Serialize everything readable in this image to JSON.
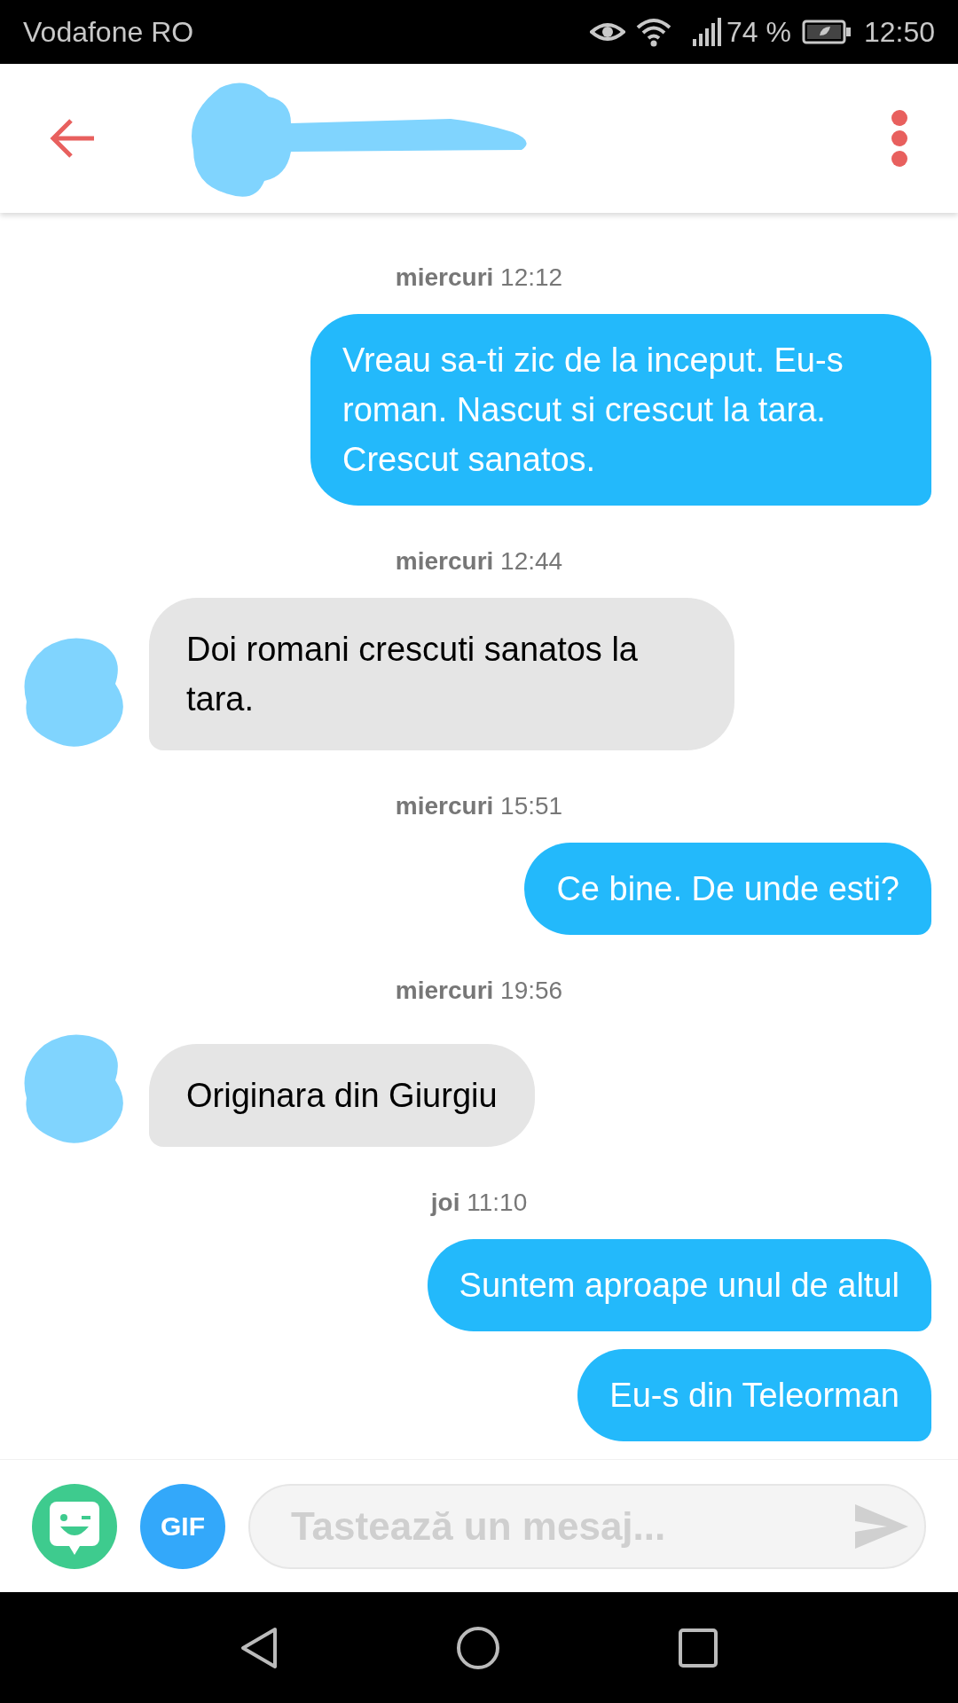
{
  "status_bar": {
    "carrier": "Vodafone RO",
    "battery": "74 %",
    "time": "12:50"
  },
  "messages": [
    {
      "day": "miercuri",
      "time": "12:12",
      "kind": "sent",
      "text": "Vreau sa-ti zic de la inceput. Eu-s roman. Nascut si crescut la tara. Crescut sanatos."
    },
    {
      "day": "miercuri",
      "time": "12:44",
      "kind": "received",
      "text": "Doi romani crescuti sanatos la tara."
    },
    {
      "day": "miercuri",
      "time": "15:51",
      "kind": "sent",
      "text": "Ce bine. De unde esti?"
    },
    {
      "day": "miercuri",
      "time": "19:56",
      "kind": "received",
      "text": "Originara din Giurgiu"
    },
    {
      "day": "joi",
      "time": "11:10",
      "kind": "sent",
      "text": "Suntem aproape unul de altul"
    },
    {
      "kind": "sent",
      "text": "Eu-s din Teleorman"
    }
  ],
  "composer": {
    "gif_label": "GIF",
    "placeholder": "Tastează un mesaj..."
  }
}
